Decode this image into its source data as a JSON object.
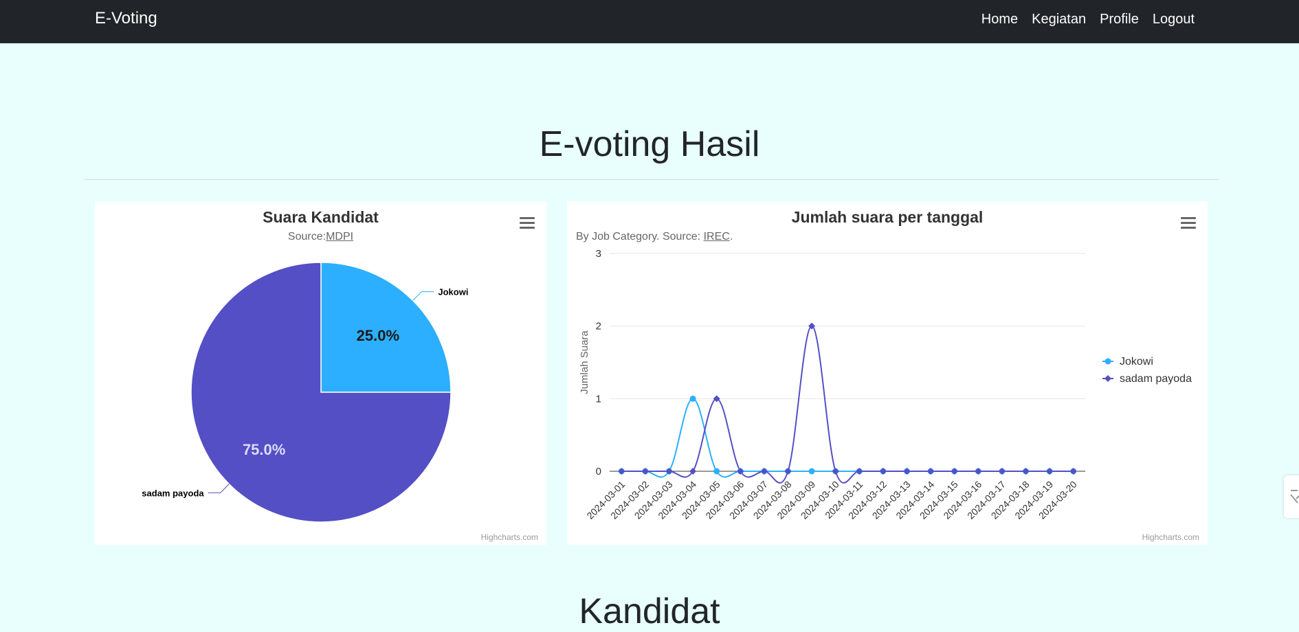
{
  "navbar": {
    "brand": "E-Voting",
    "links": [
      "Home",
      "Kegiatan",
      "Profile",
      "Logout"
    ]
  },
  "page_title": "E-voting Hasil",
  "section_title": "Kandidat",
  "colors": {
    "navbar_bg": "#212529",
    "page_bg": "#e8fffd",
    "jokowi": "#2caffe",
    "sadam": "#544fc5"
  },
  "pie_card": {
    "title": "Suara Kandidat",
    "subtitle_prefix": "Source:",
    "subtitle_link": "MDPI",
    "credits": "Highcharts.com",
    "menu_icon": "hamburger-menu-icon"
  },
  "line_card": {
    "title": "Jumlah suara per tanggal",
    "subtitle_prefix": "By Job Category. Source: ",
    "subtitle_link": "IREC",
    "subtitle_suffix": ".",
    "credits": "Highcharts.com",
    "menu_icon": "hamburger-menu-icon"
  },
  "chart_data": [
    {
      "type": "pie",
      "title": "Suara Kandidat",
      "slices": [
        {
          "name": "Jokowi",
          "value": 25.0,
          "label": "25.0%",
          "color": "#2caffe"
        },
        {
          "name": "sadam payoda",
          "value": 75.0,
          "label": "75.0%",
          "color": "#544fc5"
        }
      ]
    },
    {
      "type": "line",
      "title": "Jumlah suara per tanggal",
      "ylabel": "Jumlah Suara",
      "ylim": [
        0,
        3
      ],
      "yticks": [
        0,
        1,
        2,
        3
      ],
      "grid": true,
      "legend": "right",
      "categories": [
        "2024-03-01",
        "2024-03-02",
        "2024-03-03",
        "2024-03-04",
        "2024-03-05",
        "2024-03-06",
        "2024-03-07",
        "2024-03-08",
        "2024-03-09",
        "2024-03-10",
        "2024-03-11",
        "2024-03-12",
        "2024-03-13",
        "2024-03-14",
        "2024-03-15",
        "2024-03-16",
        "2024-03-17",
        "2024-03-18",
        "2024-03-19",
        "2024-03-20"
      ],
      "series": [
        {
          "name": "Jokowi",
          "color": "#2caffe",
          "marker": "circle",
          "values": [
            0,
            0,
            0,
            1,
            0,
            0,
            0,
            0,
            0,
            0,
            0,
            0,
            0,
            0,
            0,
            0,
            0,
            0,
            0,
            0
          ]
        },
        {
          "name": "sadam payoda",
          "color": "#544fc5",
          "marker": "diamond",
          "values": [
            0,
            0,
            0,
            0,
            1,
            0,
            0,
            0,
            2,
            0,
            0,
            0,
            0,
            0,
            0,
            0,
            0,
            0,
            0,
            0
          ]
        }
      ]
    }
  ]
}
